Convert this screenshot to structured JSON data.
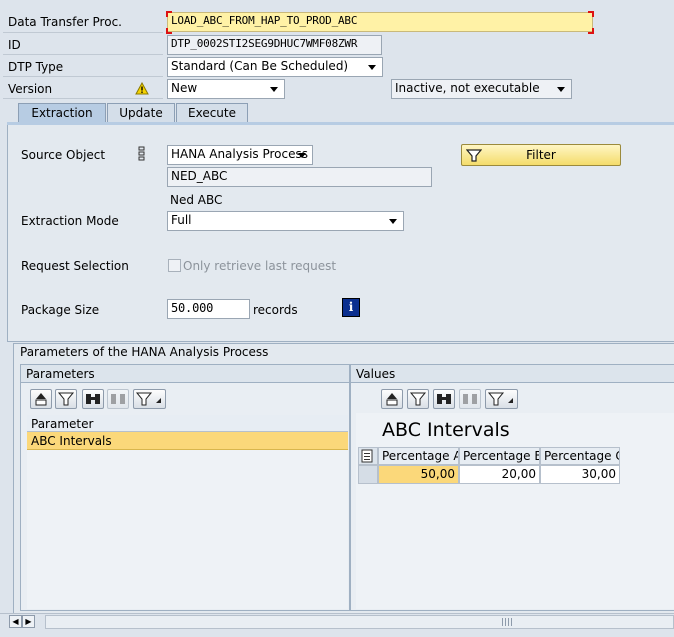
{
  "header": {
    "dtp_label": "Data Transfer Proc.",
    "dtp_value": "LOAD_ABC_FROM_HAP_TO_PROD_ABC",
    "id_label": "ID",
    "id_value": "DTP_0002STI2SEG9DHUC7WMF08ZWR",
    "type_label": "DTP Type",
    "type_value": "Standard (Can Be Scheduled)",
    "version_label": "Version",
    "version_value": "New",
    "status_value": "Inactive, not executable"
  },
  "tabs": [
    {
      "label": "Extraction",
      "active": true
    },
    {
      "label": "Update",
      "active": false
    },
    {
      "label": "Execute",
      "active": false
    }
  ],
  "extraction": {
    "source_label": "Source Object",
    "source_value": "HANA Analysis Process",
    "source_name": "NED_ABC",
    "source_desc": "Ned ABC",
    "filter_label": "Filter",
    "mode_label": "Extraction Mode",
    "mode_value": "Full",
    "request_label": "Request Selection",
    "request_checkbox_label": "Only retrieve last request",
    "package_label": "Package Size",
    "package_value": "50.000",
    "package_unit": "records"
  },
  "params_section": {
    "title": "Parameters of the HANA Analysis Process",
    "left_title": "Parameters",
    "right_title": "Values",
    "param_col_header": "Parameter",
    "param_rows": [
      "ABC Intervals"
    ],
    "values_title": "ABC Intervals",
    "value_headers": [
      "Percentage A",
      "Percentage B",
      "Percentage C"
    ],
    "value_rows": [
      [
        "50,00",
        "20,00",
        "30,00"
      ]
    ]
  }
}
